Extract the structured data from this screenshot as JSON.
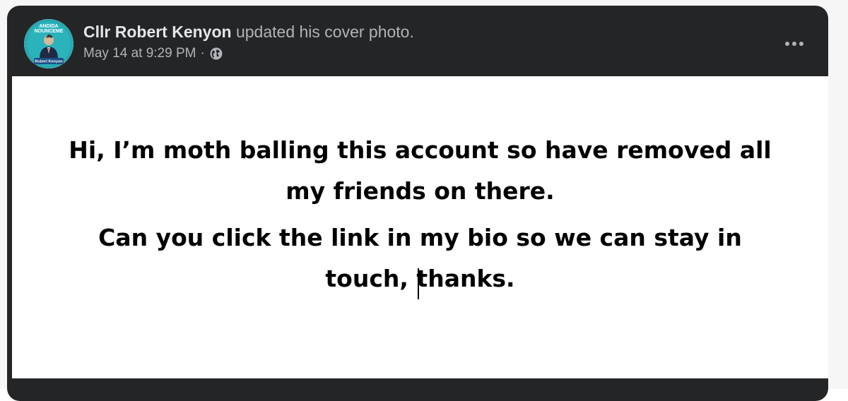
{
  "post": {
    "author": "Cllr Robert Kenyon",
    "action": "updated his cover photo.",
    "timestamp": "May 14 at 9:29 PM",
    "separator": "·",
    "privacy_icon": "globe-icon",
    "more_icon": "more-options-icon"
  },
  "avatar": {
    "top_text_1": "ANDIDA",
    "top_text_2": "NOUNCEME",
    "name_banner": "Robert Kenyon",
    "ring_color": "#29a7b0"
  },
  "cover": {
    "paragraph_1": {
      "line_1": "Hi, I’m moth balling this account so have removed all",
      "line_2": "my friends on there."
    },
    "paragraph_2": {
      "line_1": "Can you click the link in my bio so we can stay in",
      "line_2": "touch, thanks."
    }
  },
  "colors": {
    "card_background": "#242526",
    "primary_text": "#e4e6eb",
    "secondary_text": "#b0b3b8",
    "cover_background": "#ffffff"
  }
}
